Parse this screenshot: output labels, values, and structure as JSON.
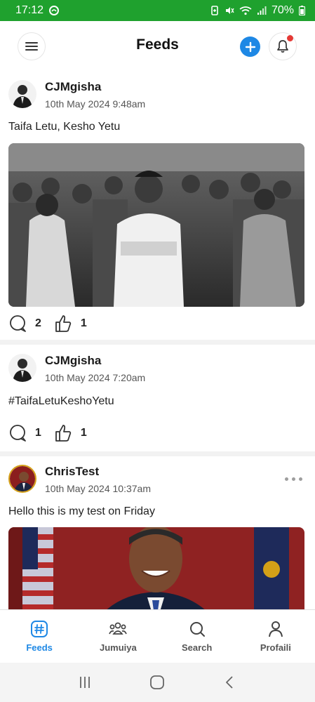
{
  "status_bar": {
    "time": "17:12",
    "battery": "70%"
  },
  "header": {
    "title": "Feeds"
  },
  "posts": [
    {
      "author": "CJMgisha",
      "date": "10th May 2024 9:48am",
      "text": "Taifa Letu, Kesho Yetu",
      "comments": "2",
      "likes": "1",
      "has_image": true
    },
    {
      "author": "CJMgisha",
      "date": "10th May 2024 7:20am",
      "text": "#TaifaLetuKeshoYetu",
      "comments": "1",
      "likes": "1",
      "has_image": false
    },
    {
      "author": "ChrisTest",
      "date": "10th May 2024 10:37am",
      "text": "Hello this is my test on Friday",
      "has_image": true
    }
  ],
  "bottom_nav": {
    "items": [
      {
        "label": "Feeds",
        "icon": "hashtag-icon",
        "active": true
      },
      {
        "label": "Jumuiya",
        "icon": "community-icon",
        "active": false
      },
      {
        "label": "Search",
        "icon": "search-icon",
        "active": false
      },
      {
        "label": "Profaili",
        "icon": "profile-icon",
        "active": false
      }
    ]
  },
  "colors": {
    "status_bar": "#1fa12e",
    "accent": "#1e88e5",
    "notification_dot": "#e53935"
  }
}
